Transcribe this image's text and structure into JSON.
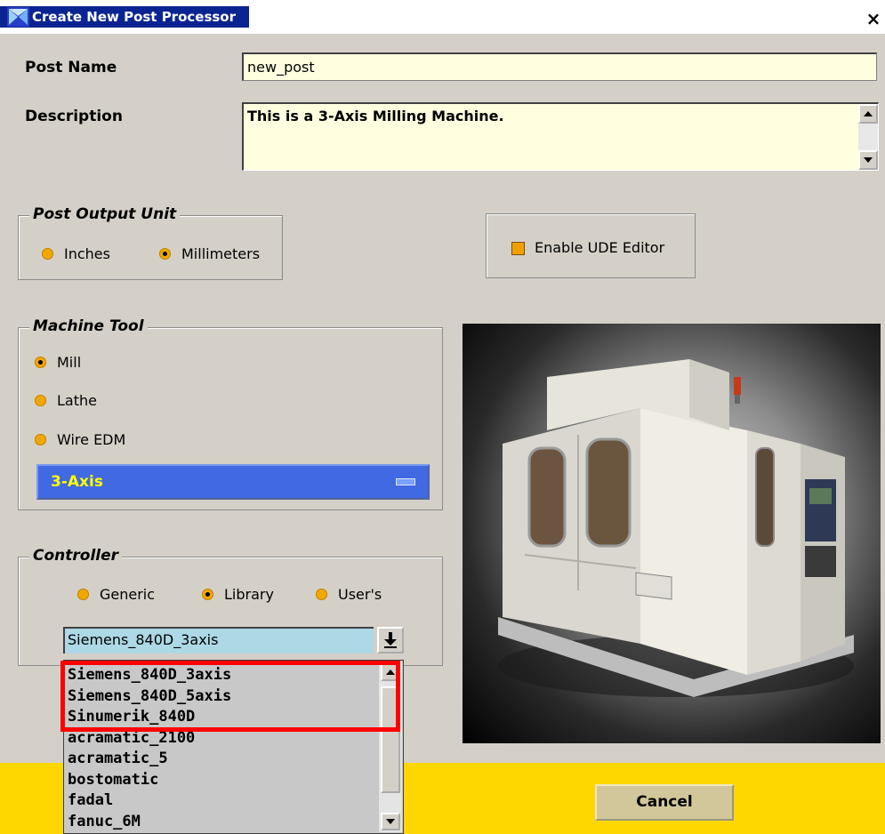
{
  "window": {
    "title": "Create New Post Processor",
    "close_symbol": "×"
  },
  "post_name": {
    "label": "Post Name",
    "value": "new_post"
  },
  "description": {
    "label": "Description",
    "value": "This is a 3-Axis Milling Machine."
  },
  "output_unit": {
    "legend": "Post Output Unit",
    "options": [
      "Inches",
      "Millimeters"
    ],
    "selected": "Millimeters"
  },
  "ude_editor": {
    "label": "Enable UDE Editor",
    "checked": true
  },
  "machine_tool": {
    "legend": "Machine Tool",
    "options": [
      "Mill",
      "Lathe",
      "Wire EDM"
    ],
    "selected": "Mill",
    "axis_option": "3-Axis"
  },
  "controller": {
    "legend": "Controller",
    "options": [
      "Generic",
      "Library",
      "User's"
    ],
    "selected": "Library",
    "combo_value": "Siemens_840D_3axis",
    "dropdown_items": [
      "Siemens_840D_3axis",
      "Siemens_840D_5axis",
      "Sinumerik_840D",
      "acramatic_2100",
      "acramatic_5",
      "bostomatic",
      "fadal",
      "fanuc_6M"
    ]
  },
  "buttons": {
    "cancel": "Cancel"
  },
  "colors": {
    "title_bar": "#0b2491",
    "input_bg": "#ffffe0",
    "radio": "#f0a800",
    "option_menu": "#4169e1",
    "option_menu_text": "#ffff00",
    "bottom_bar": "#ffd700",
    "highlight": "#ff0000"
  }
}
